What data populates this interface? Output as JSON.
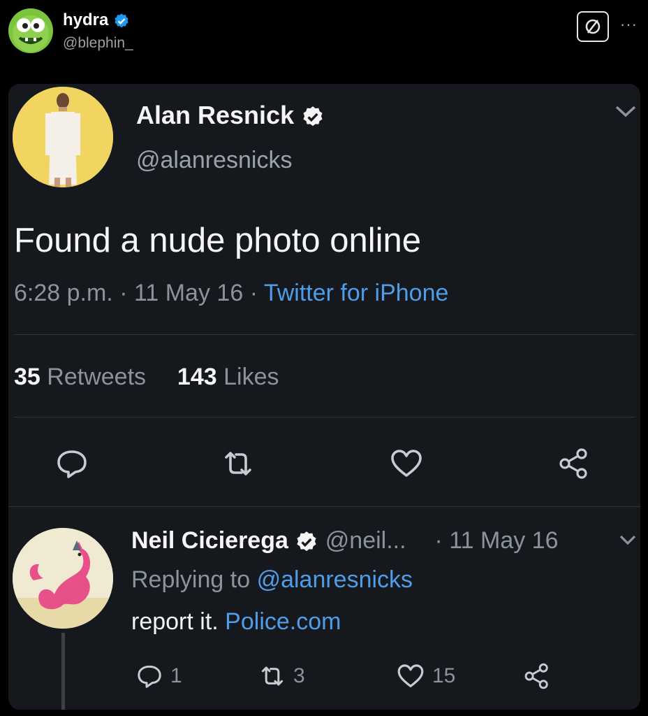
{
  "poster": {
    "name": "hydra",
    "handle": "@blephin_"
  },
  "tweet": {
    "author_name": "Alan Resnick",
    "author_handle": "@alanresnicks",
    "text": "Found a nude photo online",
    "time": "6:28 p.m.",
    "date": "11 May 16",
    "source": "Twitter for iPhone",
    "retweets_count": "35",
    "retweets_label": "Retweets",
    "likes_count": "143",
    "likes_label": "Likes"
  },
  "reply": {
    "author_name": "Neil Cicierega",
    "author_handle": "@neil...",
    "date": "· 11 May 16",
    "replying_prefix": "Replying to",
    "replying_handle": "@alanresnicks",
    "text": "report it.",
    "link": "Police.com",
    "reply_count": "1",
    "retweet_count": "3",
    "like_count": "15"
  },
  "icons": {
    "verified": "verified-badge-icon",
    "nsfw": "blocked-circle-icon",
    "more": "more-dots-icon",
    "chevron": "chevron-down-icon",
    "reply": "reply-icon",
    "retweet": "retweet-icon",
    "like": "heart-icon",
    "share": "share-icon"
  },
  "colors": {
    "background": "#000000",
    "card": "#15181c",
    "link": "#4f9de8",
    "muted": "#8b939b",
    "verified": "#1d9bf0"
  }
}
